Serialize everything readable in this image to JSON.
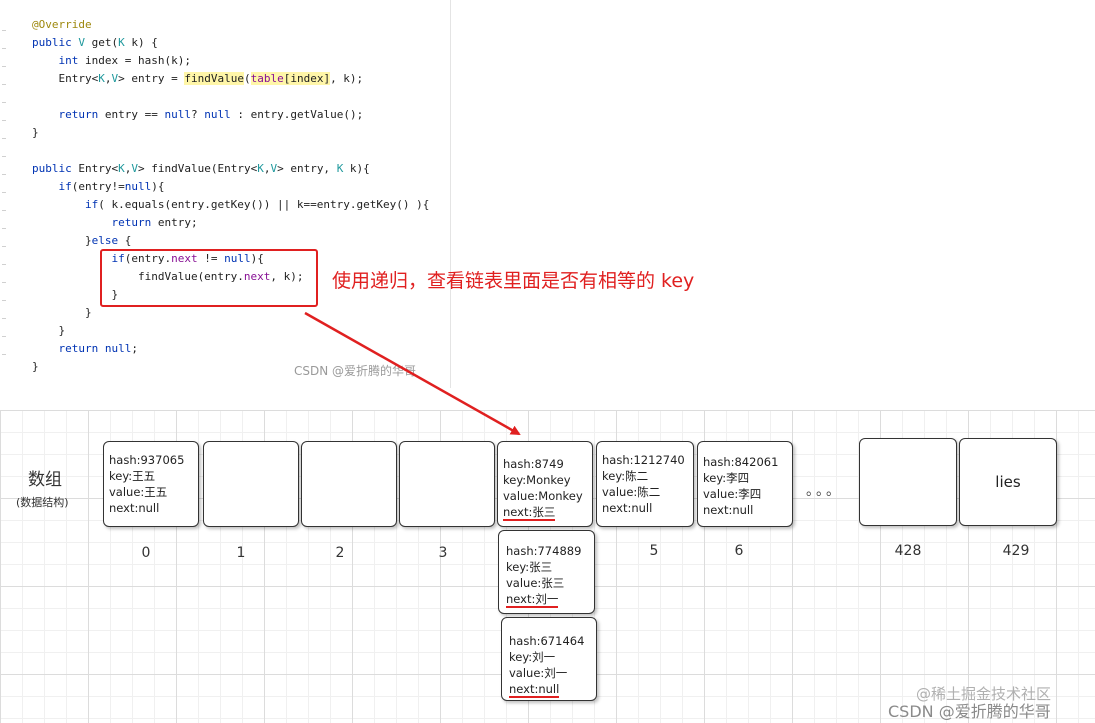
{
  "code": {
    "lines": [
      "@Override",
      "public V get(K k) {",
      "    int index = hash(k);",
      "    Entry<K,V> entry = findValue(table[index], k);",
      "",
      "    return entry == null? null : entry.getValue();",
      "}",
      "",
      "public Entry<K,V> findValue(Entry<K,V> entry, K k){",
      "    if(entry!=null){",
      "        if( k.equals(entry.getKey()) || k==entry.getKey() ){",
      "            return entry;",
      "        }else {",
      "            if(entry.next != null){",
      "                findValue(entry.next, k);",
      "            }",
      "        }",
      "    }",
      "    return null;",
      "}"
    ]
  },
  "callout": "使用递归，查看链表里面是否有相等的 key",
  "watermark_code": "CSDN @爱折腾的华哥",
  "watermark_bottom": [
    "@稀土掘金技术社区",
    "CSDN @爱折腾的华哥"
  ],
  "array_label": {
    "title": "数组",
    "subtitle": "(数据结构)"
  },
  "cells": [
    {
      "index": "0",
      "entry": {
        "hash": "hash:937065",
        "key": "key:王五",
        "value": "value:王五",
        "next": "next:null"
      }
    },
    {
      "index": "1"
    },
    {
      "index": "2"
    },
    {
      "index": "3"
    },
    {
      "index": "",
      "entry": {
        "hash": "hash:8749",
        "key": "key:Monkey",
        "value": "value:Monkey",
        "next": "next:张三"
      }
    },
    {
      "index": "5",
      "entry": {
        "hash": "hash:1212740",
        "key": "key:陈二",
        "value": "value:陈二",
        "next": "next:null"
      }
    },
    {
      "index": "6",
      "entry": {
        "hash": "hash:842061",
        "key": "key:李四",
        "value": "value:李四",
        "next": "next:null"
      }
    },
    {
      "index": "428"
    },
    {
      "index": "429",
      "text": "lies"
    }
  ],
  "ellipsis": "。。。",
  "chain": [
    {
      "hash": "hash:774889",
      "key": "key:张三",
      "value": "value:张三",
      "next": "next:刘一"
    },
    {
      "hash": "hash:671464",
      "key": "key:刘一",
      "value": "value:刘一",
      "next": "next:null"
    }
  ],
  "colors": {
    "highlight": "#e02020",
    "border": "#333333"
  }
}
